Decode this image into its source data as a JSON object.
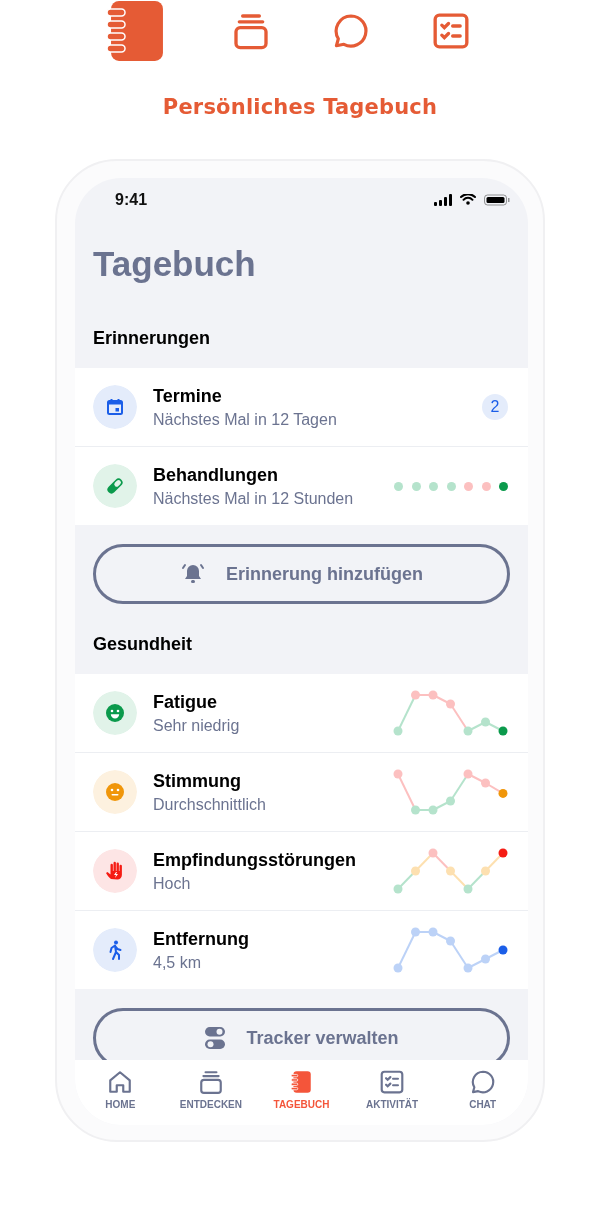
{
  "features": [
    {
      "selected": true
    },
    {
      "selected": false
    },
    {
      "selected": false
    },
    {
      "selected": false
    }
  ],
  "caption": "Persönliches Tagebuch",
  "status_bar": {
    "time": "9:41"
  },
  "title": "Tagebuch",
  "reminders": {
    "heading": "Erinnerungen",
    "items": [
      {
        "title": "Termine",
        "subtitle": "Nächstes Mal in 12 Tagen",
        "badge": "2"
      },
      {
        "title": "Behandlungen",
        "subtitle": "Nächstes Mal in 12 Stunden",
        "dots": [
          {
            "color": "#b5e3cc"
          },
          {
            "color": "#b5e3cc"
          },
          {
            "color": "#b5e3cc"
          },
          {
            "color": "#b5e3cc"
          },
          {
            "color": "#fcc0c0"
          },
          {
            "color": "#fcc0c0"
          },
          {
            "color": "#0b9a4c"
          }
        ]
      }
    ],
    "button": "Erinnerung hinzufügen"
  },
  "health": {
    "heading": "Gesundheit",
    "items": [
      {
        "title": "Fatigue",
        "value": "Sehr niedrig",
        "color": "#0b9a4c"
      },
      {
        "title": "Stimmung",
        "value": "Durchschnittlich",
        "color": "#f0960a"
      },
      {
        "title": "Empfindungsstörungen",
        "value": "Hoch",
        "color": "#f51c14"
      },
      {
        "title": "Entfernung",
        "value": "4,5 km",
        "color": "#1b5ee8"
      }
    ],
    "button": "Tracker verwalten"
  },
  "tabs": [
    {
      "label": "HOME",
      "selected": false
    },
    {
      "label": "ENTDECKEN",
      "selected": false
    },
    {
      "label": "TAGEBUCH",
      "selected": true
    },
    {
      "label": "AKTIVITÄT",
      "selected": false
    },
    {
      "label": "CHAT",
      "selected": false
    }
  ]
}
